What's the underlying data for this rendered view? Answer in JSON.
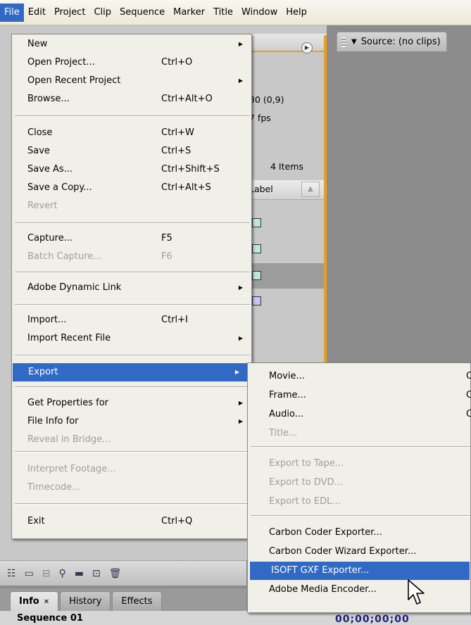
{
  "menubar": {
    "items": [
      "File",
      "Edit",
      "Project",
      "Clip",
      "Sequence",
      "Marker",
      "Title",
      "Window",
      "Help"
    ],
    "active": "File"
  },
  "project_panel": {
    "info_line1": "80 (0,9)",
    "info_line2": "7 fps",
    "items_count": "4 Items",
    "column_label": "Label",
    "swatch_colors": [
      "#bfe6e0",
      "#bfe6e0",
      "#bfe6e0",
      "#c3c6f2"
    ]
  },
  "source_panel": {
    "tab_label": "Source: (no clips)"
  },
  "file_menu": {
    "items": [
      {
        "label": "New",
        "shortcut": "",
        "submenu": true,
        "disabled": false
      },
      {
        "label": "Open Project...",
        "shortcut": "Ctrl+O",
        "submenu": false,
        "disabled": false
      },
      {
        "label": "Open Recent Project",
        "shortcut": "",
        "submenu": true,
        "disabled": false
      },
      {
        "label": "Browse...",
        "shortcut": "Ctrl+Alt+O",
        "submenu": false,
        "disabled": false
      },
      {
        "label": "Close",
        "shortcut": "Ctrl+W",
        "submenu": false,
        "disabled": false
      },
      {
        "label": "Save",
        "shortcut": "Ctrl+S",
        "submenu": false,
        "disabled": false
      },
      {
        "label": "Save As...",
        "shortcut": "Ctrl+Shift+S",
        "submenu": false,
        "disabled": false
      },
      {
        "label": "Save a Copy...",
        "shortcut": "Ctrl+Alt+S",
        "submenu": false,
        "disabled": false
      },
      {
        "label": "Revert",
        "shortcut": "",
        "submenu": false,
        "disabled": true
      },
      {
        "label": "Capture...",
        "shortcut": "F5",
        "submenu": false,
        "disabled": false
      },
      {
        "label": "Batch Capture...",
        "shortcut": "F6",
        "submenu": false,
        "disabled": true
      },
      {
        "label": "Adobe Dynamic Link",
        "shortcut": "",
        "submenu": true,
        "disabled": false
      },
      {
        "label": "Import...",
        "shortcut": "Ctrl+I",
        "submenu": false,
        "disabled": false
      },
      {
        "label": "Import Recent File",
        "shortcut": "",
        "submenu": true,
        "disabled": false
      },
      {
        "label": "Export",
        "shortcut": "",
        "submenu": true,
        "disabled": false,
        "highlighted": true
      },
      {
        "label": "Get Properties for",
        "shortcut": "",
        "submenu": true,
        "disabled": false
      },
      {
        "label": "File Info for",
        "shortcut": "",
        "submenu": true,
        "disabled": false
      },
      {
        "label": "Reveal in Bridge...",
        "shortcut": "",
        "submenu": false,
        "disabled": true
      },
      {
        "label": "Interpret Footage...",
        "shortcut": "",
        "submenu": false,
        "disabled": true
      },
      {
        "label": "Timecode...",
        "shortcut": "",
        "submenu": false,
        "disabled": true
      },
      {
        "label": "Exit",
        "shortcut": "Ctrl+Q",
        "submenu": false,
        "disabled": false
      }
    ]
  },
  "export_menu": {
    "items": [
      {
        "label": "Movie...",
        "shortcut": "C",
        "disabled": false
      },
      {
        "label": "Frame...",
        "shortcut": "C",
        "disabled": false
      },
      {
        "label": "Audio...",
        "shortcut": "C",
        "disabled": false
      },
      {
        "label": "Title...",
        "shortcut": "",
        "disabled": true
      },
      {
        "label": "Export to Tape...",
        "shortcut": "",
        "disabled": true
      },
      {
        "label": "Export to DVD...",
        "shortcut": "",
        "disabled": true
      },
      {
        "label": "Export to EDL...",
        "shortcut": "",
        "disabled": true
      },
      {
        "label": "Carbon Coder Exporter...",
        "shortcut": "",
        "disabled": false
      },
      {
        "label": "Carbon Coder Wizard Exporter...",
        "shortcut": "",
        "disabled": false
      },
      {
        "label": "ISOFT GXF Exporter...",
        "shortcut": "",
        "disabled": false,
        "highlighted": true
      },
      {
        "label": "Adobe Media Encoder...",
        "shortcut": "",
        "disabled": false
      }
    ]
  },
  "bottom_tabs": {
    "tabs": [
      "Info",
      "History",
      "Effects"
    ],
    "active": "Info",
    "close_glyph": "✕"
  },
  "info_strip": {
    "title": "Sequence 01",
    "timecode": "00;00;00;00"
  },
  "icons": {
    "submenu_arrow": "▶",
    "panel_menu": "▶",
    "source_dropdown": "▼",
    "sort": "▲"
  }
}
